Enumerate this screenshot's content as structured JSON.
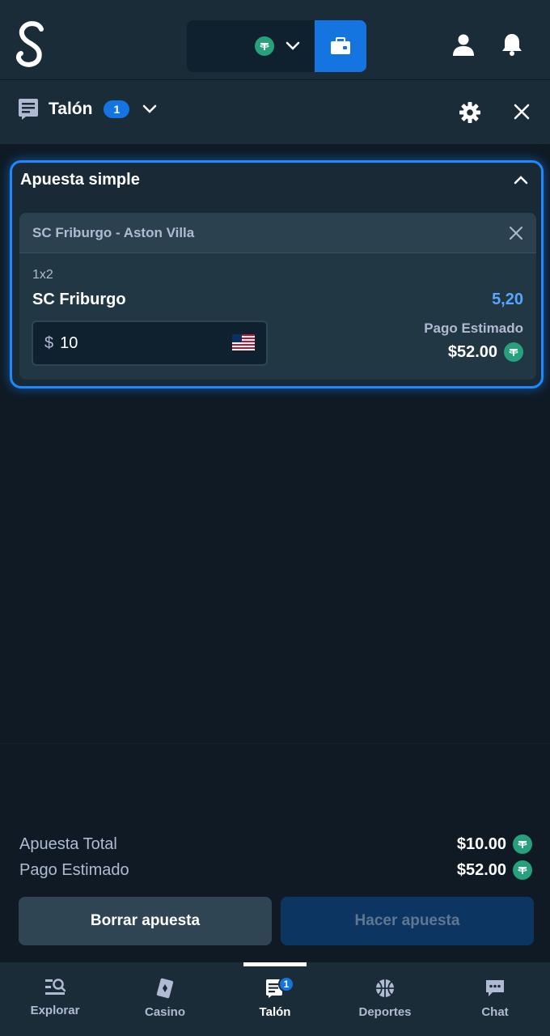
{
  "header": {
    "logo_icon": "stake-logo-icon",
    "currency_icon": "tether-icon",
    "wallet_icon": "wallet-icon",
    "user_icon": "user-icon",
    "bell_icon": "bell-icon"
  },
  "betslip": {
    "title": "Talón",
    "count": "1",
    "bet_type": "Apuesta simple",
    "bet": {
      "event": "SC Friburgo - Aston Villa",
      "market": "1x2",
      "selection": "SC Friburgo",
      "odds": "5,20",
      "stake_currency": "$",
      "stake": "10",
      "payout_label": "Pago Estimado",
      "payout": "$52.00"
    }
  },
  "summary": {
    "total_stake_label": "Apuesta Total",
    "total_stake": "$10.00",
    "payout_label": "Pago Estimado",
    "payout": "$52.00"
  },
  "actions": {
    "clear_label": "Borrar apuesta",
    "place_label": "Hacer apuesta"
  },
  "bottom_nav": {
    "items": [
      {
        "label": "Explorar",
        "icon": "browse-icon"
      },
      {
        "label": "Casino",
        "icon": "casino-cards-icon"
      },
      {
        "label": "Talón",
        "icon": "betslip-icon",
        "badge": "1",
        "active": true
      },
      {
        "label": "Deportes",
        "icon": "basketball-icon"
      },
      {
        "label": "Chat",
        "icon": "chat-icon"
      }
    ]
  },
  "colors": {
    "accent_blue": "#1475e1",
    "odds_blue": "#58a6ff",
    "tether_green": "#26a17b",
    "background": "#0f1a24"
  }
}
